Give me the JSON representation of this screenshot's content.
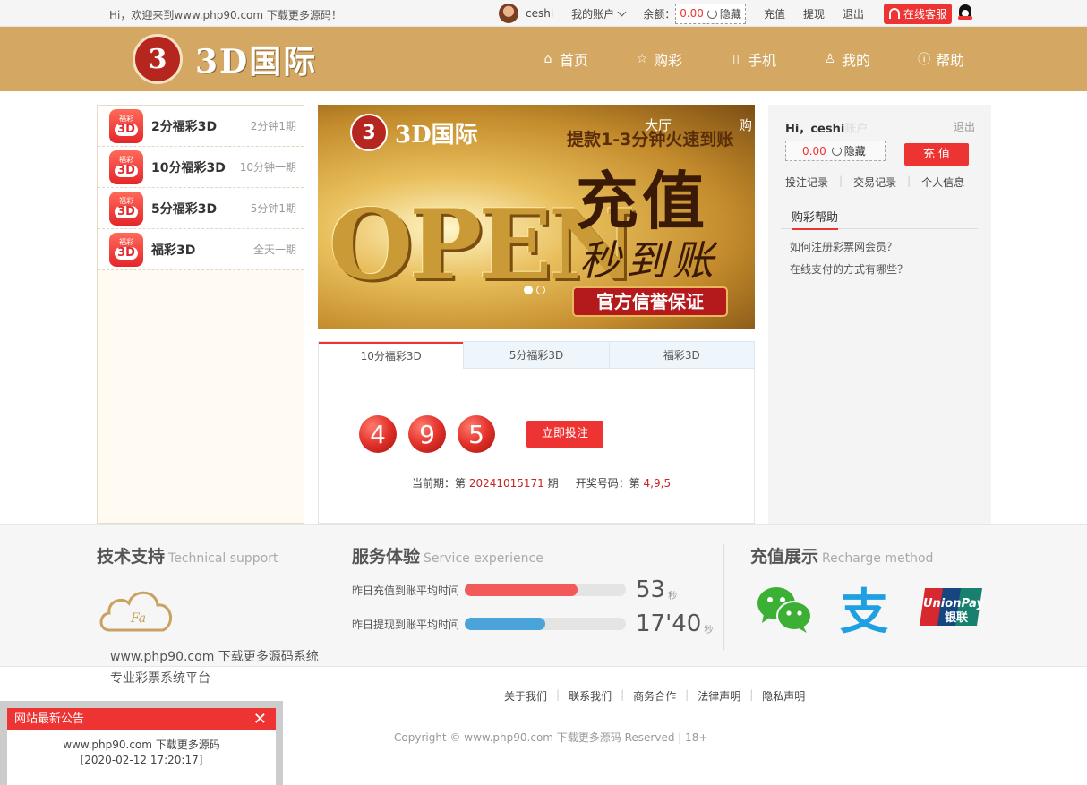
{
  "topbar": {
    "welcome": "Hi，欢迎来到www.php90.com 下载更多源码！",
    "username": "ceshi",
    "my_account": "我的账户",
    "balance_label": "余额：",
    "balance": "0.00",
    "hide": "隐藏",
    "recharge": "充值",
    "withdraw": "提现",
    "logout": "退出",
    "online_service": "在线客服"
  },
  "header": {
    "logo_mark": "3",
    "logo_text": "3D国际",
    "nav": [
      {
        "label": "首页",
        "icon": "home-icon"
      },
      {
        "label": "购彩",
        "icon": "star-icon"
      },
      {
        "label": "手机",
        "icon": "phone-icon"
      },
      {
        "label": "我的",
        "icon": "user-icon"
      },
      {
        "label": "帮助",
        "icon": "help-icon"
      }
    ]
  },
  "lotteries": [
    {
      "name": "2分福彩3D",
      "freq": "2分钟1期",
      "icon_top": "福彩",
      "icon_big": "3D"
    },
    {
      "name": "10分福彩3D",
      "freq": "10分钟一期",
      "icon_top": "福彩",
      "icon_big": "3D"
    },
    {
      "name": "5分福彩3D",
      "freq": "5分钟1期",
      "icon_top": "福彩",
      "icon_big": "3D"
    },
    {
      "name": "福彩3D",
      "freq": "全天一期",
      "icon_top": "福彩",
      "icon_big": "3D"
    }
  ],
  "banner": {
    "logo_text": "3D国际",
    "hall": "大厅",
    "buy": "购",
    "subtitle": "提款1-3分钟火速到账",
    "headline": "充值",
    "headline2": "秒到账",
    "open": "OPEN",
    "ribbon": "官方信誉保证"
  },
  "result": {
    "tabs": [
      "10分福彩3D",
      "5分福彩3D",
      "福彩3D"
    ],
    "active_tab": 0,
    "balls": [
      "4",
      "9",
      "5"
    ],
    "bet_button": "立即投注",
    "issue_label": "当前期：第 ",
    "issue_number": "20241015171",
    "issue_suffix": " 期",
    "draw_label": "开奖号码：第 ",
    "draw_numbers": "4,9,5"
  },
  "user_panel": {
    "greeting": "Hi，ceshi",
    "overlap": "账户",
    "logout": "退出",
    "balance": "0.00",
    "hide": "隐藏",
    "recharge": "充 值",
    "links": [
      "投注记录",
      "交易记录",
      "个人信息"
    ],
    "help_title": "购彩帮助",
    "questions": [
      "如何注册彩票网会员？",
      "在线支付的方式有哪些？"
    ]
  },
  "services": {
    "tech_title": "技术支持",
    "tech_en": "Technical support",
    "cloud_text": "Fa",
    "tech_line1": "www.php90.com 下载更多源码系统",
    "tech_line2": "专业彩票系统平台",
    "exp_title": "服务体验",
    "exp_en": "Service experience",
    "bars": [
      {
        "label": "昨日充值到账平均时间",
        "value": "53",
        "unit": "秒",
        "fill": 0.7,
        "color": "#f25a5a"
      },
      {
        "label": "昨日提现到账平均时间",
        "value": "17'40",
        "unit": "秒",
        "fill": 0.5,
        "color": "#4aa3d9"
      }
    ],
    "pay_title": "充值展示",
    "pay_en": "Recharge method",
    "pay_methods": [
      "wechat-icon",
      "alipay-icon",
      "unionpay-icon"
    ],
    "unionpay_text": "UnionPay",
    "unionpay_cn": "银联",
    "alipay_glyph": "支"
  },
  "footer": {
    "links": [
      "关于我们",
      "联系我们",
      "商务合作",
      "法律声明",
      "隐私声明"
    ],
    "copyright": "Copyright © www.php90.com 下载更多源码 Reserved | 18+"
  },
  "notice": {
    "title": "网站最新公告",
    "close": "✕",
    "text": "www.php90.com 下载更多源码",
    "date": "[2020-02-12 17:20:17]"
  }
}
